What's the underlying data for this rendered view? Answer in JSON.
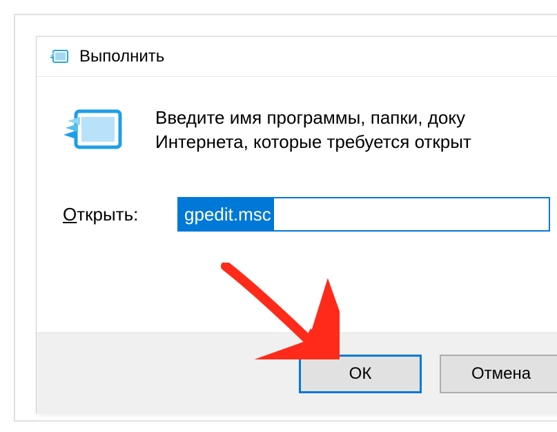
{
  "dialog": {
    "title": "Выполнить",
    "instruction_line1": "Введите имя программы, папки, доку",
    "instruction_line2": "Интернета, которые требуется открыт",
    "open_label_underline": "О",
    "open_label_rest": "ткрыть:",
    "input_value": "gpedit.msc",
    "ok_label": "ОК",
    "cancel_label": "Отмена"
  },
  "colors": {
    "accent": "#0078d7",
    "arrow": "#ff2a1a"
  }
}
